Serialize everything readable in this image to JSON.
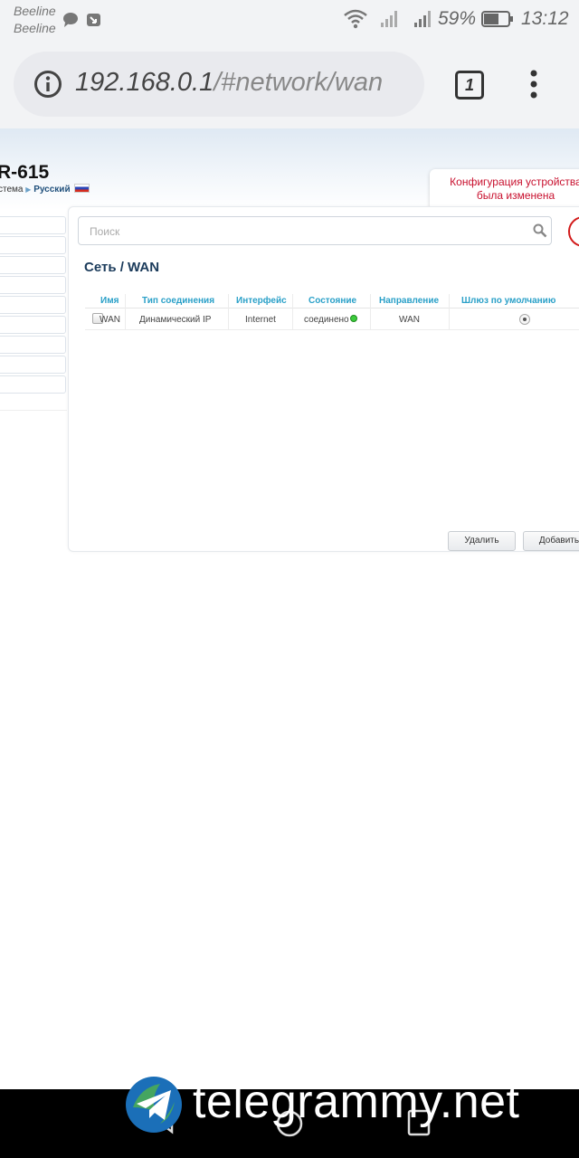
{
  "status_bar": {
    "carrier_1": "Beeline",
    "carrier_2": "Beeline",
    "battery": "59%",
    "time": "13:12",
    "icons": [
      "message-icon",
      "missed-call-icon",
      "wifi-icon",
      "signal-icon",
      "signal-icon",
      "battery-icon"
    ]
  },
  "browser": {
    "url_host": "192.168.0.1",
    "url_path": "/#network/wan",
    "tab_count": "1"
  },
  "router": {
    "model": "R-615",
    "breadcrumb_system": "стема",
    "breadcrumb_language": "Русский",
    "notice_line1": "Конфигурация устройства",
    "notice_line2": "была изменена"
  },
  "main": {
    "search_placeholder": "Поиск",
    "title": "Сеть /  WAN",
    "columns": [
      "Имя",
      "Тип соединения",
      "Интерфейс",
      "Состояние",
      "Направление",
      "Шлюз по умолчанию"
    ],
    "rows": [
      {
        "name": "WAN",
        "type": "Динамический IP",
        "interface": "Internet",
        "state": "соединено",
        "direction": "WAN",
        "default_gateway": true
      }
    ],
    "delete_button": "Удалить",
    "add_button": "Добавить"
  },
  "watermark": {
    "text": "telegrammy.net"
  },
  "colors": {
    "accent": "#2aa0c8",
    "title": "#1b3b5b",
    "notice": "#c8102e",
    "status_ok": "#3ccb3c"
  }
}
